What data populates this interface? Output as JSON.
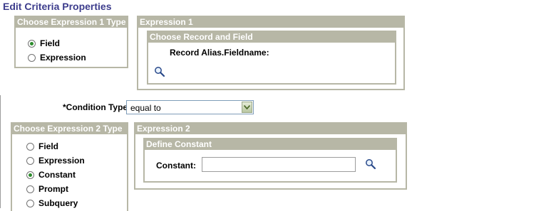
{
  "page": {
    "title": "Edit Criteria Properties"
  },
  "expr1_type": {
    "header": "Choose Expression 1 Type",
    "options": [
      {
        "label": "Field",
        "selected": true
      },
      {
        "label": "Expression",
        "selected": false
      }
    ]
  },
  "expression1": {
    "header": "Expression 1",
    "record_field": {
      "header": "Choose Record and Field",
      "alias_label": "Record Alias.Fieldname:",
      "lookup_icon": "magnifier-icon"
    }
  },
  "condition": {
    "label": "*Condition Type:",
    "value": "equal to"
  },
  "expr2_type": {
    "header": "Choose Expression 2 Type",
    "options": [
      {
        "label": "Field",
        "selected": false
      },
      {
        "label": "Expression",
        "selected": false
      },
      {
        "label": "Constant",
        "selected": true
      },
      {
        "label": "Prompt",
        "selected": false
      },
      {
        "label": "Subquery",
        "selected": false
      }
    ]
  },
  "expression2": {
    "header": "Expression 2",
    "constant": {
      "header": "Define Constant",
      "label": "Constant:",
      "value": "",
      "lookup_icon": "magnifier-icon"
    }
  },
  "colors": {
    "title": "#3c3c8c",
    "group_header": "#b7b7a6",
    "radio_dot": "#2d8c2d"
  }
}
